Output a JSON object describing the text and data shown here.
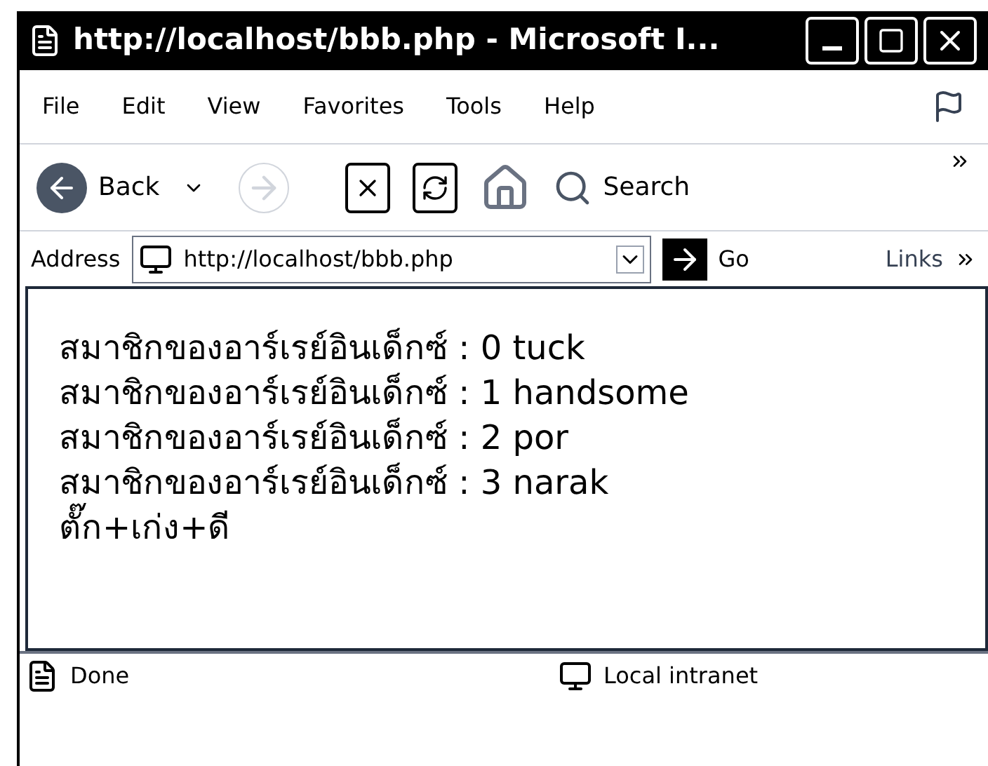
{
  "window": {
    "title": "http://localhost/bbb.php - Microsoft I..."
  },
  "menu": [
    "File",
    "Edit",
    "View",
    "Favorites",
    "Tools",
    "Help"
  ],
  "toolbar": {
    "back": "Back",
    "search": "Search"
  },
  "address_bar": {
    "label": "Address",
    "value": "http://localhost/bbb.php",
    "go": "Go",
    "links": "Links"
  },
  "content": {
    "lines": [
      "สมาชิกของอาร์เรย์อินเด็กซ์ : 0 tuck",
      "สมาชิกของอาร์เรย์อินเด็กซ์ : 1 handsome",
      "สมาชิกของอาร์เรย์อินเด็กซ์ : 2 por",
      "สมาชิกของอาร์เรย์อินเด็กซ์ : 3 narak",
      "ตั๊ก+เก่ง+ดี"
    ]
  },
  "status_bar": {
    "text": "Done",
    "zone": "Local intranet"
  }
}
